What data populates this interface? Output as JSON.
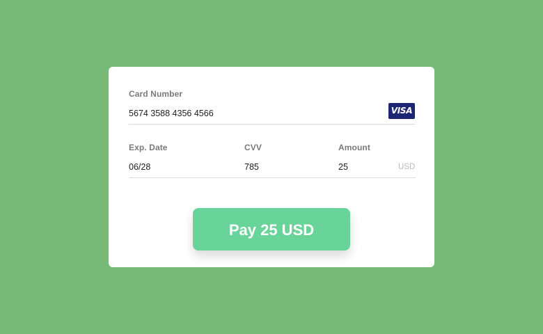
{
  "form": {
    "card_number": {
      "label": "Card Number",
      "value": "5674 3588 4356 4566",
      "brand_logo_text": "VISA"
    },
    "exp_date": {
      "label": "Exp. Date",
      "value": "06/28"
    },
    "cvv": {
      "label": "CVV",
      "value": "785"
    },
    "amount": {
      "label": "Amount",
      "value": "25",
      "currency": "USD"
    },
    "pay_button_label": "Pay 25 USD"
  },
  "colors": {
    "background": "#77b978",
    "button": "#69d49a",
    "visa_logo": "#1d2673"
  }
}
